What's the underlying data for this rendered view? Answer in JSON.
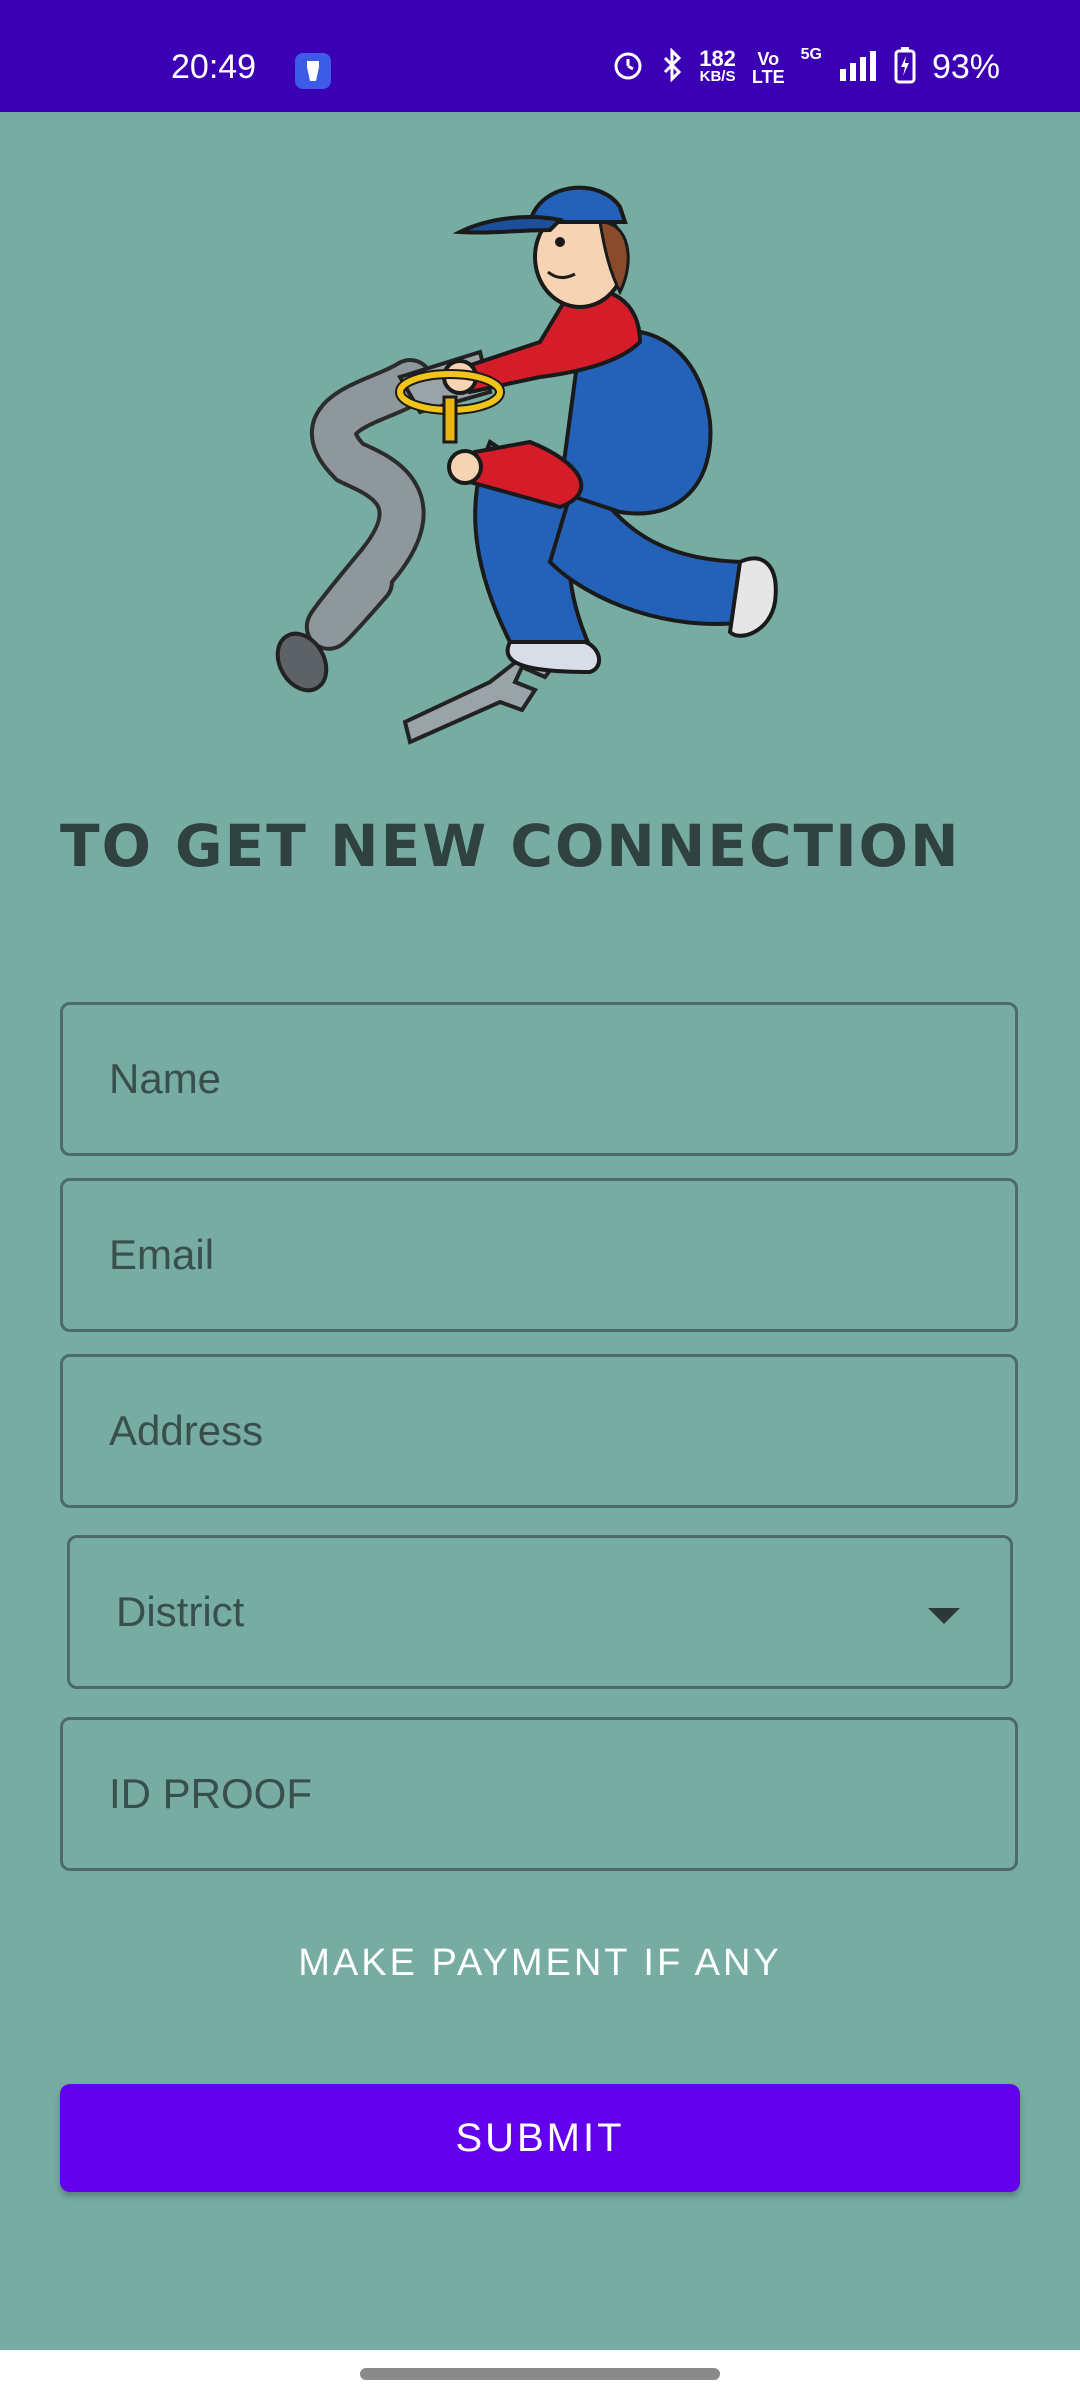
{
  "status_bar": {
    "time": "20:49",
    "network_speed_value": "182",
    "network_speed_unit": "KB/S",
    "volte_top": "Vo",
    "volte_bottom": "LTE",
    "network_type": "5G",
    "battery": "93%"
  },
  "header": {
    "title": "TO GET NEW CONNECTION"
  },
  "form": {
    "name_label": "Name",
    "email_label": "Email",
    "address_label": "Address",
    "district_label": "District",
    "id_proof_label": "ID PROOF"
  },
  "actions": {
    "payment_label": "MAKE PAYMENT IF ANY",
    "submit_label": "SUBMIT"
  },
  "colors": {
    "status_bar": "#3c00b4",
    "background": "#76aca1",
    "submit": "#6200ee",
    "title": "#2f4240"
  }
}
